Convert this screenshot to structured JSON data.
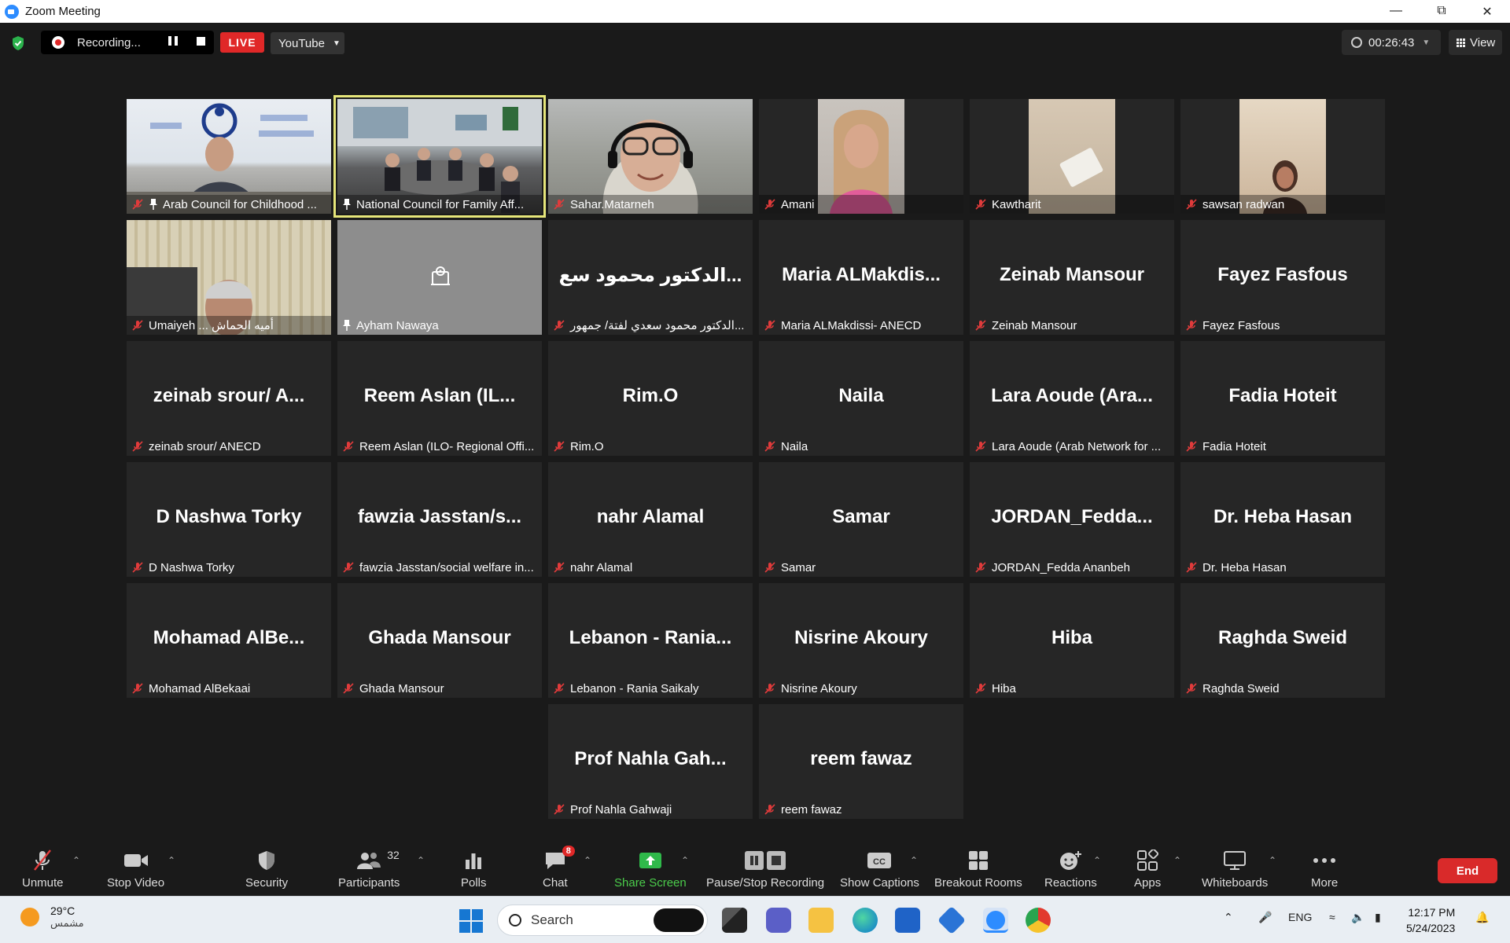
{
  "window": {
    "title": "Zoom Meeting"
  },
  "recording": {
    "status": "Recording...",
    "live_label": "LIVE",
    "stream_target": "YouTube"
  },
  "meeting": {
    "elapsed": "00:26:43",
    "view_label": "View"
  },
  "participants": [
    {
      "label": "Arab Council for Childhood ...",
      "tile": "video"
    },
    {
      "label": "National Council for Family Aff...",
      "tile": "video"
    },
    {
      "label": "Sahar.Matarneh",
      "tile": "video"
    },
    {
      "label": "Amani",
      "tile": "video"
    },
    {
      "label": "Kawtharit",
      "tile": "video"
    },
    {
      "label": "sawsan radwan",
      "tile": "video"
    },
    {
      "label": "Umaiyeh ... أميه الحماش",
      "tile": "video"
    },
    {
      "label": "Ayham Nawaya",
      "tile": "camera-off"
    },
    {
      "big": "الدكتور محمود سع...",
      "label": "الدكتور محمود سعدي لفتة/ جمهور...",
      "tile": "name"
    },
    {
      "big": "Maria  ALMakdis...",
      "label": "Maria ALMakdissi- ANECD",
      "tile": "name"
    },
    {
      "big": "Zeinab Mansour",
      "label": "Zeinab Mansour",
      "tile": "name"
    },
    {
      "big": "Fayez Fasfous",
      "label": "Fayez Fasfous",
      "tile": "name"
    },
    {
      "big": "zeinab srour/ A...",
      "label": "zeinab srour/ ANECD",
      "tile": "name"
    },
    {
      "big": "Reem Aslan (IL...",
      "label": "Reem Aslan (ILO- Regional Offi...",
      "tile": "name"
    },
    {
      "big": "Rim.O",
      "label": "Rim.O",
      "tile": "name"
    },
    {
      "big": "Naila",
      "label": "Naila",
      "tile": "name"
    },
    {
      "big": "Lara Aoude (Ara...",
      "label": "Lara Aoude (Arab Network for ...",
      "tile": "name"
    },
    {
      "big": "Fadia Hoteit",
      "label": "Fadia Hoteit",
      "tile": "name"
    },
    {
      "big": "D Nashwa Torky",
      "label": "D Nashwa Torky",
      "tile": "name"
    },
    {
      "big": "fawzia  Jasstan/s...",
      "label": "fawzia Jasstan/social welfare in...",
      "tile": "name"
    },
    {
      "big": "nahr Alamal",
      "label": "nahr Alamal",
      "tile": "name"
    },
    {
      "big": "Samar",
      "label": "Samar",
      "tile": "name"
    },
    {
      "big": "JORDAN_Fedda...",
      "label": "JORDAN_Fedda Ananbeh",
      "tile": "name"
    },
    {
      "big": "Dr. Heba Hasan",
      "label": "Dr. Heba Hasan",
      "tile": "name"
    },
    {
      "big": "Mohamad  AlBe...",
      "label": "Mohamad AlBekaai",
      "tile": "name"
    },
    {
      "big": "Ghada Mansour",
      "label": "Ghada Mansour",
      "tile": "name"
    },
    {
      "big": "Lebanon  -  Rania...",
      "label": "Lebanon - Rania Saikaly",
      "tile": "name"
    },
    {
      "big": "Nisrine Akoury",
      "label": "Nisrine Akoury",
      "tile": "name"
    },
    {
      "big": "Hiba",
      "label": "Hiba",
      "tile": "name"
    },
    {
      "big": "Raghda Sweid",
      "label": "Raghda Sweid",
      "tile": "name"
    },
    {
      "big": "Prof Nahla Gah...",
      "label": "Prof Nahla Gahwaji",
      "tile": "name"
    },
    {
      "big": "reem fawaz",
      "label": "reem fawaz",
      "tile": "name"
    }
  ],
  "toolbar": {
    "unmute": "Unmute",
    "stop_video": "Stop Video",
    "security": "Security",
    "participants": "Participants",
    "participants_count": "32",
    "polls": "Polls",
    "chat": "Chat",
    "chat_badge": "8",
    "share_screen": "Share Screen",
    "pause_stop_recording": "Pause/Stop Recording",
    "show_captions": "Show Captions",
    "breakout_rooms": "Breakout Rooms",
    "reactions": "Reactions",
    "apps": "Apps",
    "whiteboards": "Whiteboards",
    "more": "More",
    "end": "End"
  },
  "taskbar": {
    "temperature": "29°C",
    "weather": "مشمس",
    "search_placeholder": "Search",
    "language": "ENG",
    "time": "12:17 PM",
    "date": "5/24/2023"
  },
  "colors": {
    "live_red": "#e02828",
    "active_speaker": "#e6e67a",
    "share_green": "#4bcc4b",
    "end_red": "#d92a2a"
  }
}
